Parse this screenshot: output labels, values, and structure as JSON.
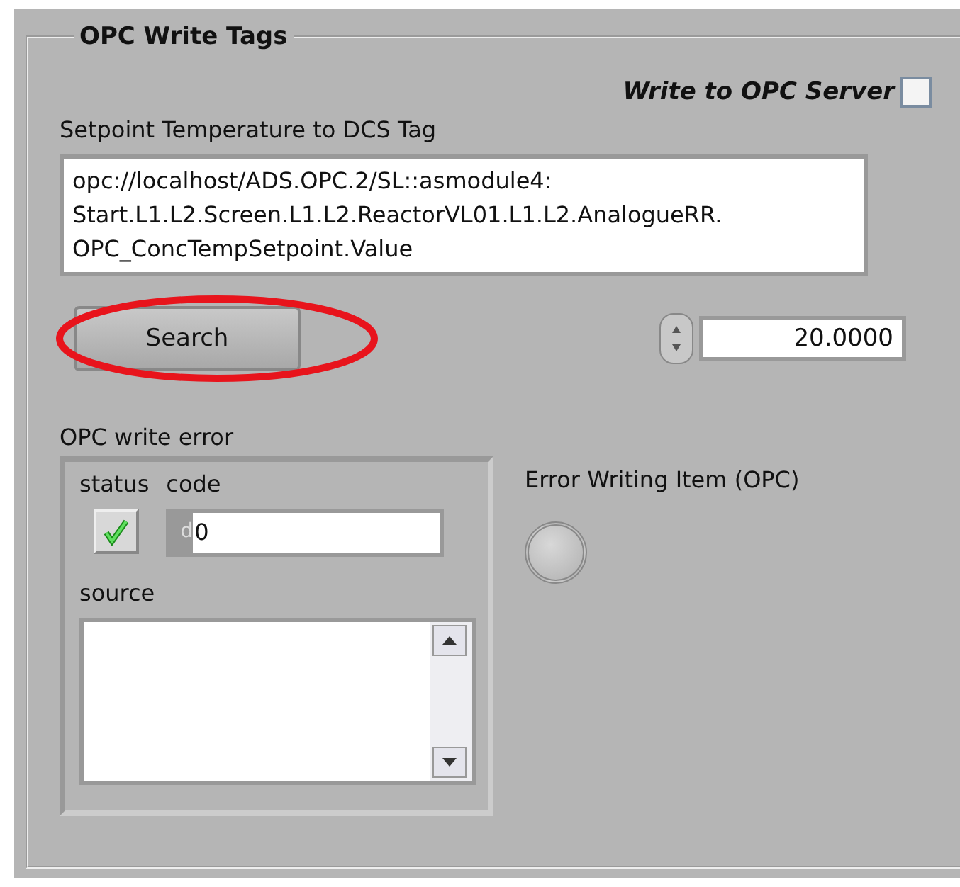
{
  "group": {
    "title": "OPC Write Tags"
  },
  "write_to_server": {
    "label": "Write to OPC Server",
    "checked": false
  },
  "tag_field": {
    "label": "Setpoint Temperature to DCS Tag",
    "value": "opc://localhost/ADS.OPC.2/SL::asmodule4:\nStart.L1.L2.Screen.L1.L2.ReactorVL01.L1.L2.AnalogueRR.\nOPC_ConcTempSetpoint.Value"
  },
  "search_button": {
    "label": "Search",
    "highlighted": true
  },
  "setpoint": {
    "value": "20.0000"
  },
  "error_cluster": {
    "label": "OPC write error",
    "status_label": "status",
    "status": true,
    "code_label": "code",
    "radix": "d",
    "code": "0",
    "source_label": "source"
  },
  "error_led": {
    "label": "Error Writing Item (OPC)",
    "on": false
  }
}
